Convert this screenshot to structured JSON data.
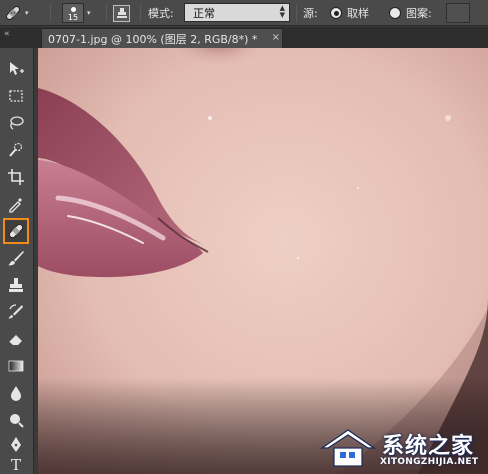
{
  "options_bar": {
    "brush_size": "15",
    "mode_label": "模式:",
    "mode_value": "正常",
    "source_label": "源:",
    "source_sample_label": "取样",
    "source_pattern_label": "图案:",
    "source_selected": "sampled"
  },
  "document_tab": {
    "title": "0707-1.jpg @ 100% (图层 2, RGB/8*) *",
    "close_glyph": "×"
  },
  "toolbar": {
    "tools": [
      "move-tool-icon",
      "rectangular-marquee-icon",
      "lasso-icon",
      "quick-selection-icon",
      "crop-icon",
      "eyedropper-icon",
      "healing-brush-icon",
      "brush-icon",
      "clone-stamp-icon",
      "history-brush-icon",
      "eraser-icon",
      "gradient-icon",
      "blur-icon",
      "dodge-icon",
      "pen-icon",
      "type-icon"
    ],
    "active_tool": "healing-brush-icon",
    "type_tool_glyph": "T"
  },
  "watermark": {
    "title": "系统之家",
    "subtitle": "XITONGZHIJIA.NET"
  },
  "colors": {
    "active_tool_outline": "#f28a1c",
    "panel": "#4a4a4a",
    "select_bg": "#d9d9d9",
    "skin": "#e7c3b8",
    "lip": "#a8586e"
  }
}
